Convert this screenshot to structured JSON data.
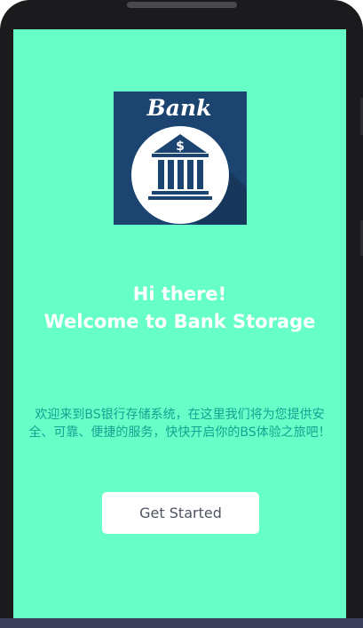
{
  "logo": {
    "wordmark": "Bank",
    "symbol": "$",
    "icon": "bank-building-icon",
    "background_color": "#1c4470"
  },
  "welcome": {
    "line1": "Hi there!",
    "line2": "Welcome to Bank Storage"
  },
  "intro": {
    "text": "欢迎来到BS银行存储系统，在这里我们将为您提供安全、可靠、便捷的服务，快快开启你的BS体验之旅吧！"
  },
  "actions": {
    "get_started_label": "Get Started"
  },
  "colors": {
    "screen_background": "#66ffc8",
    "intro_text": "#17a190",
    "button_text": "#4d5361"
  }
}
